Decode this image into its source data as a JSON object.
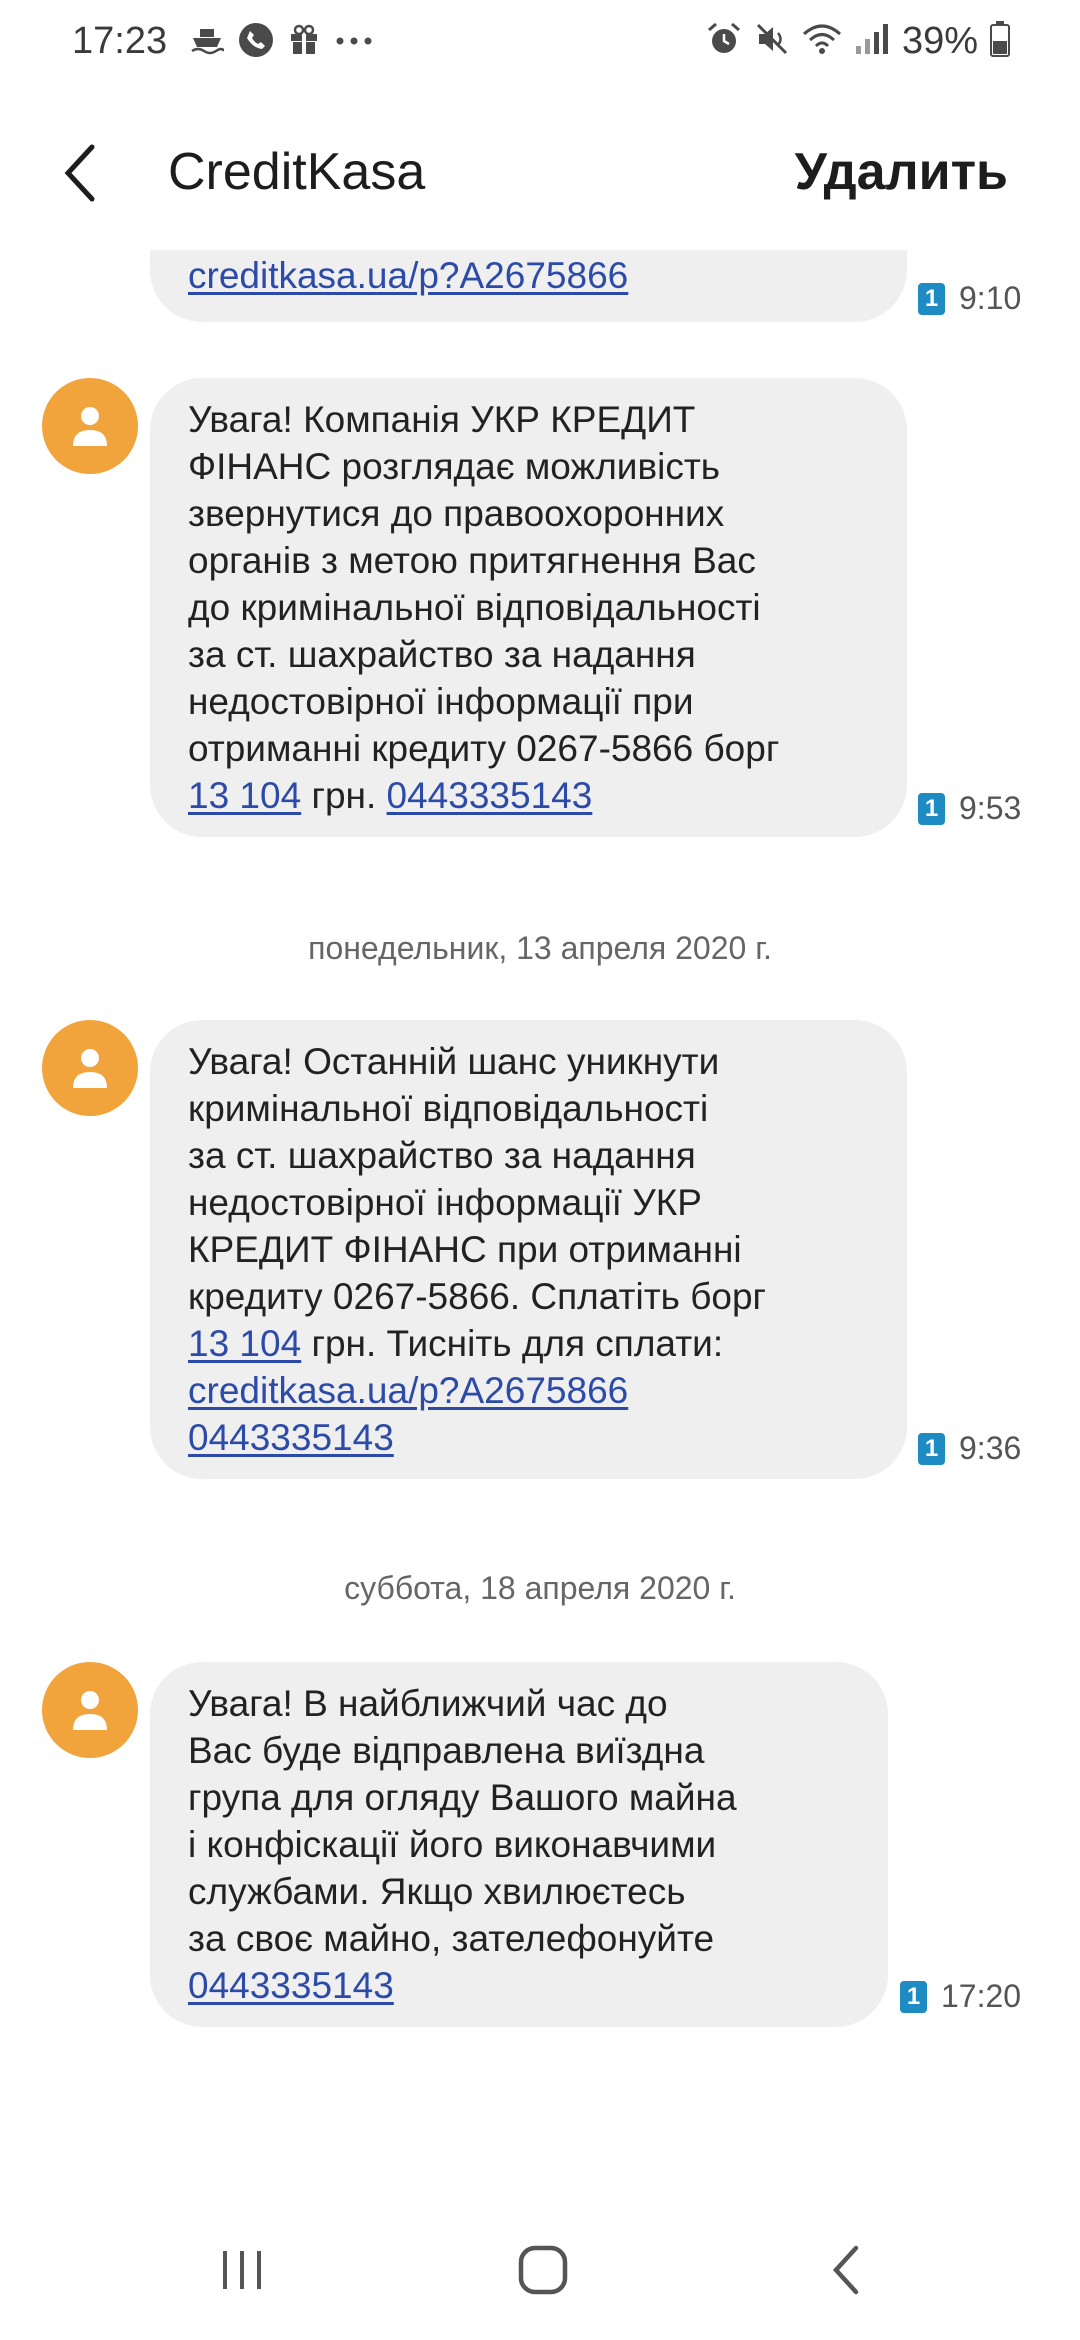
{
  "status_bar": {
    "time": "17:23",
    "battery": "39%",
    "left_icons": [
      "ferry-icon",
      "call-icon",
      "gift-icon",
      "more-dots-icon"
    ],
    "right_icons": [
      "alarm-icon",
      "mute-icon",
      "wifi-icon",
      "signal-icon",
      "battery-icon"
    ]
  },
  "header": {
    "title": "CreditKasa",
    "delete_label": "Удалить",
    "back_icon": "back-arrow-icon"
  },
  "messages": [
    {
      "lines": [
        [
          {
            "text": "creditkasa.ua/p?A2675866",
            "link": true
          }
        ]
      ],
      "sim": "1",
      "time": "9:10"
    },
    {
      "lines": [
        [
          {
            "text": "Увага! Компанія УКР КРЕДИТ",
            "link": false
          }
        ],
        [
          {
            "text": "ФІНАНС розглядає можливість",
            "link": false
          }
        ],
        [
          {
            "text": "звернутися до правоохоронних",
            "link": false
          }
        ],
        [
          {
            "text": "органів з метою притягнення Вас",
            "link": false
          }
        ],
        [
          {
            "text": "до кримінальної відповідальності",
            "link": false
          }
        ],
        [
          {
            "text": "за ст. шахрайство за надання",
            "link": false
          }
        ],
        [
          {
            "text": "недостовірної інформації при",
            "link": false
          }
        ],
        [
          {
            "text": "отриманні кредиту 0267-5866 борг",
            "link": false
          }
        ],
        [
          {
            "text": "13 104",
            "link": true
          },
          {
            "text": " грн. ",
            "link": false
          },
          {
            "text": "0443335143",
            "link": true
          }
        ]
      ],
      "sim": "1",
      "time": "9:53"
    },
    {
      "date_separator": "понедельник, 13 апреля 2020 г."
    },
    {
      "lines": [
        [
          {
            "text": "Увага! Останній шанс уникнути",
            "link": false
          }
        ],
        [
          {
            "text": "кримінальної відповідальності",
            "link": false
          }
        ],
        [
          {
            "text": "за ст. шахрайство за надання",
            "link": false
          }
        ],
        [
          {
            "text": "недостовірної інформації УКР",
            "link": false
          }
        ],
        [
          {
            "text": "КРЕДИТ ФІНАНС при отриманні",
            "link": false
          }
        ],
        [
          {
            "text": "кредиту 0267-5866. Сплатіть борг",
            "link": false
          }
        ],
        [
          {
            "text": "13 104",
            "link": true
          },
          {
            "text": " грн. Тисніть для сплати:",
            "link": false
          }
        ],
        [
          {
            "text": "creditkasa.ua/p?A2675866",
            "link": true
          }
        ],
        [
          {
            "text": "0443335143",
            "link": true
          }
        ]
      ],
      "sim": "1",
      "time": "9:36"
    },
    {
      "date_separator": "суббота, 18 апреля 2020 г."
    },
    {
      "lines": [
        [
          {
            "text": "Увага! В найближчий час до",
            "link": false
          }
        ],
        [
          {
            "text": "Вас буде відправлена виїздна",
            "link": false
          }
        ],
        [
          {
            "text": "група для огляду Вашого майна",
            "link": false
          }
        ],
        [
          {
            "text": "і конфіскації його виконавчими",
            "link": false
          }
        ],
        [
          {
            "text": "службами. Якщо хвилюєтесь",
            "link": false
          }
        ],
        [
          {
            "text": "за своє майно, зателефонуйте",
            "link": false
          }
        ],
        [
          {
            "text": "0443335143",
            "link": true
          }
        ]
      ],
      "sim": "1",
      "time": "17:20"
    }
  ],
  "nav_bar": {
    "items": [
      "recent-apps-icon",
      "home-icon",
      "back-icon"
    ]
  },
  "colors": {
    "bubble": "#efefef",
    "avatar": "#f1a33c",
    "link": "#2c4aa8",
    "sim_badge": "#1e8bc3"
  }
}
